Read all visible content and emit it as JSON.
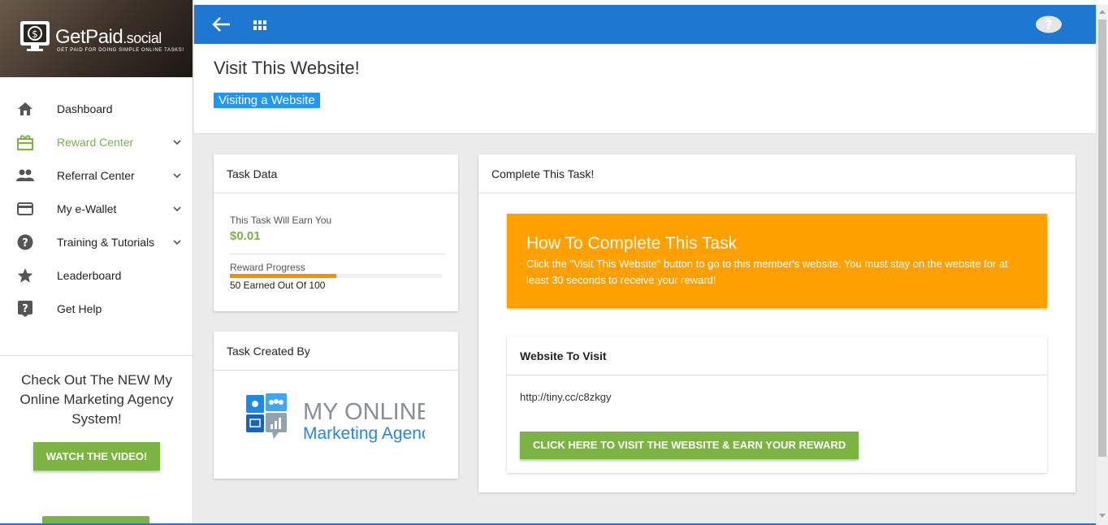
{
  "brand": {
    "name": "GetPaid",
    "suffix": ".social",
    "tagline": "GET PAID FOR DOING SIMPLE ONLINE TASKS!"
  },
  "sidebar": {
    "items": [
      {
        "label": "Dashboard",
        "icon": "home-icon",
        "expandable": false
      },
      {
        "label": "Reward Center",
        "icon": "gift-icon",
        "expandable": true,
        "active": true
      },
      {
        "label": "Referral Center",
        "icon": "people-icon",
        "expandable": true
      },
      {
        "label": "My e-Wallet",
        "icon": "credit-card-icon",
        "expandable": true
      },
      {
        "label": "Training & Tutorials",
        "icon": "help-circle-icon",
        "expandable": true
      },
      {
        "label": "Leaderboard",
        "icon": "star-icon",
        "expandable": false
      },
      {
        "label": "Get Help",
        "icon": "help-box-icon",
        "expandable": false
      }
    ],
    "promo": {
      "text": "Check Out The NEW My Online Marketing Agency System!",
      "button": "WATCH THE VIDEO!"
    }
  },
  "topbar": {
    "back_icon": "arrow-left-icon",
    "apps_icon": "grid-icon",
    "help_icon": "help-bubble-icon"
  },
  "header": {
    "title": "Visit This Website!",
    "badge": "Visiting a Website"
  },
  "task_data": {
    "title": "Task Data",
    "earn_label": "This Task Will Earn You",
    "earn_value": "$0.01",
    "progress_label": "Reward Progress",
    "progress_fraction": 0.5,
    "progress_text": "50 Earned Out Of 100"
  },
  "task_creator": {
    "title": "Task Created By",
    "logo_line1": "MY ONLINE",
    "logo_line2": "Marketing Agency"
  },
  "complete_task": {
    "title": "Complete This Task!",
    "howto_title": "How To Complete This Task",
    "howto_text": "Click the \"Visit This Website\" button to go to this member's website. You must stay on the website for at least 30 seconds to receive your reward!",
    "website_title": "Website To Visit",
    "website_url": "http://tiny.cc/c8zkgy",
    "visit_button": "CLICK HERE TO VISIT THE WEBSITE & EARN YOUR REWARD"
  },
  "colors": {
    "primary": "#1e78d2",
    "accent_green": "#7cb342",
    "orange": "#ffa000",
    "badge_blue": "#2196f3"
  }
}
